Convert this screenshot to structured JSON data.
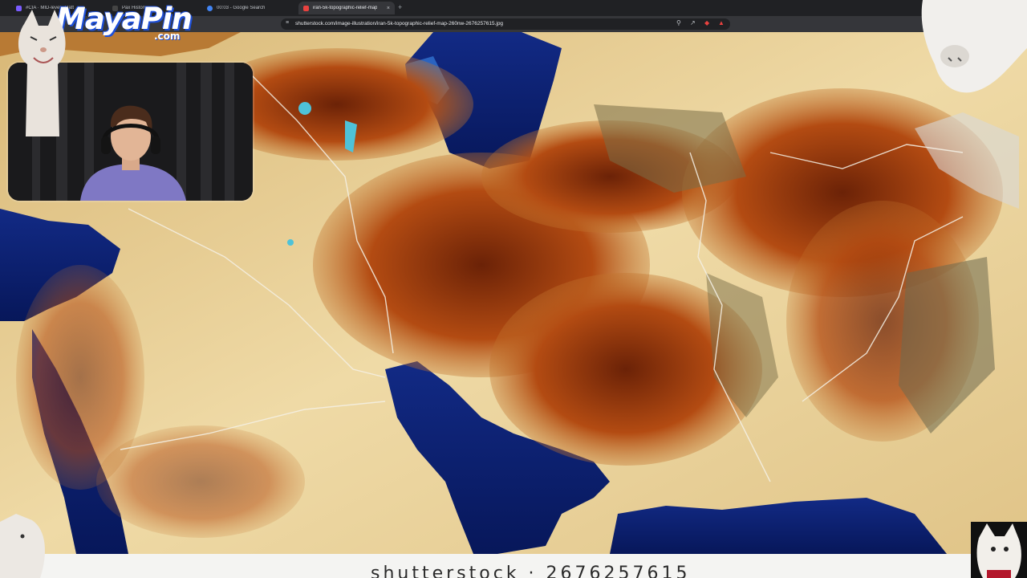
{
  "browser": {
    "tabs": [
      {
        "label": "#CIA · MID-level · Hatt",
        "active": false,
        "favicon_color": "#7a5cff"
      },
      {
        "label": "Pax Historia",
        "active": false,
        "favicon_color": "#444444"
      },
      {
        "label": "00:03 - Google Search",
        "active": false,
        "favicon_color": "#4285f4"
      },
      {
        "label": "iran-5k-topographic-relief-map",
        "active": true,
        "favicon_color": "#e8423f"
      }
    ],
    "new_tab_label": "+",
    "url": "shutterstock.com/image-illustration/iran-5k-topographic-relief-map-260nw-2676257615.jpg",
    "tab_close_glyph": "×"
  },
  "overlay": {
    "logo_text": "MayaPin",
    "logo_sub": ".com"
  },
  "image": {
    "subject": "topographic relief map",
    "watermark_partial": "shutterstock · 2676257615"
  },
  "colors": {
    "sea": "#0a1f6a",
    "shallow_sea": "#1d52b0",
    "lowland": "#e9d49b",
    "mountain": "#a8410f",
    "peak": "#5b1a05",
    "border_line": "#f5f1e6",
    "brand_blue": "#1e4fd8"
  }
}
